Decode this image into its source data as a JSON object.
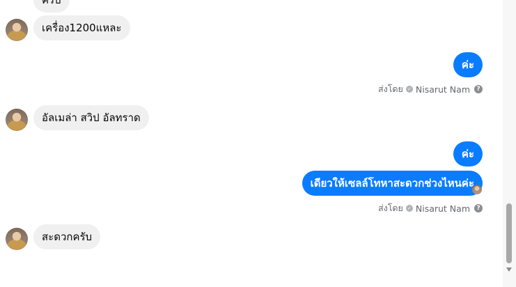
{
  "messages": {
    "m0_partial": "ครับ",
    "m1": "เครื่อง1200แหละ",
    "m2": "ค่ะ",
    "m3": "อัลเมล่า  สวิป  อัลทราด",
    "m4": "ค่ะ",
    "m5": "เดียวให้เซลล์โทหาสะดวกช่วงไหนค่ะ",
    "m6": "สะดวกครับ"
  },
  "meta": {
    "sent_by_label": "ส่งโดย",
    "sender_name": "Nisarut Nam",
    "help_glyph": "?",
    "check_glyph": "✓"
  },
  "colors": {
    "outgoing_bubble": "#0a7cff",
    "incoming_bubble": "#f0f0f0",
    "meta_text": "#65676b"
  }
}
